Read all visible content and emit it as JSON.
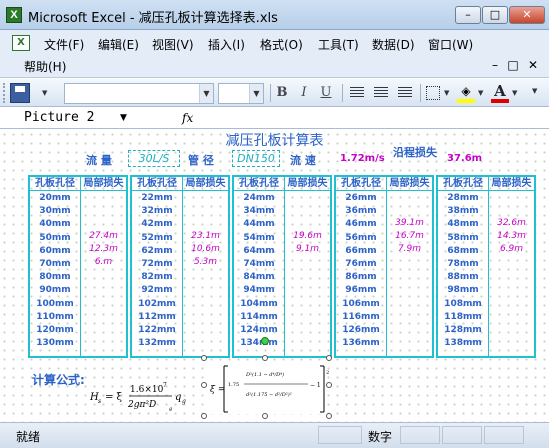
{
  "window": {
    "title": "Microsoft Excel - 减压孔板计算选择表.xls"
  },
  "menu": {
    "items": [
      "文件(F)",
      "编辑(E)",
      "视图(V)",
      "插入(I)",
      "格式(O)",
      "工具(T)",
      "数据(D)",
      "窗口(W)"
    ],
    "help": "帮助(H)"
  },
  "formula_bar": {
    "name_box": "Picture 2",
    "fx_symbol": "fx",
    "content": ""
  },
  "sheet": {
    "title": "减压孔板计算表",
    "flow_label": "流 量",
    "flow_value": "30L/S",
    "pipe_label": "管 径",
    "pipe_value": "DN150",
    "velocity_label": "流 速",
    "velocity_value": "1.72m/s",
    "head_loss_label": "沿程损失",
    "head_loss_value": "37.6m",
    "header_diam": "孔板孔径",
    "header_loss": "局部损失",
    "groups": [
      {
        "diams": [
          "20mm",
          "30mm",
          "40mm",
          "50mm",
          "60mm",
          "70mm",
          "80mm",
          "90mm",
          "100mm",
          "110mm",
          "120mm",
          "130mm"
        ],
        "losses": [
          "27.4m",
          "12.3m",
          "6.m"
        ]
      },
      {
        "diams": [
          "22mm",
          "32mm",
          "42mm",
          "52mm",
          "62mm",
          "72mm",
          "82mm",
          "92mm",
          "102mm",
          "112mm",
          "122mm",
          "132mm"
        ],
        "losses": [
          "23.1m",
          "10.6m",
          "5.3m"
        ]
      },
      {
        "diams": [
          "24mm",
          "34mm",
          "44mm",
          "54mm",
          "64mm",
          "74mm",
          "84mm",
          "94mm",
          "104mm",
          "114mm",
          "124mm",
          "134mm"
        ],
        "losses": [
          "19.6m",
          "9.1m"
        ]
      },
      {
        "diams": [
          "26mm",
          "36mm",
          "46mm",
          "56mm",
          "66mm",
          "76mm",
          "86mm",
          "96mm",
          "106mm",
          "116mm",
          "126mm",
          "136mm"
        ],
        "losses": [
          "39.1m",
          "16.7m",
          "7.9m"
        ]
      },
      {
        "diams": [
          "28mm",
          "38mm",
          "48mm",
          "58mm",
          "68mm",
          "78mm",
          "88mm",
          "98mm",
          "108mm",
          "118mm",
          "128mm",
          "138mm"
        ],
        "losses": [
          "32.6m",
          "14.3m",
          "6.9m"
        ]
      }
    ],
    "calc_label": "计算公式:"
  },
  "status": {
    "left": "就绪",
    "right": "数字"
  },
  "colors": {
    "accent": "#2d63c8",
    "magenta": "#c800c8",
    "teal": "#20c0d0"
  }
}
